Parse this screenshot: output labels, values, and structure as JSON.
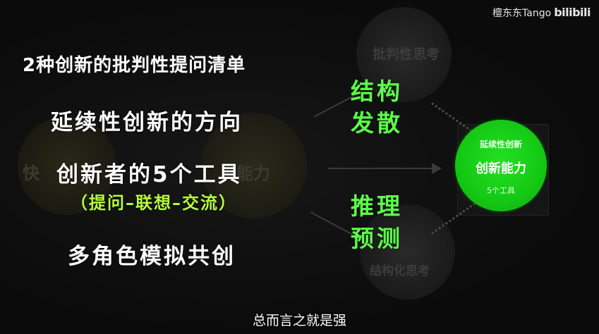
{
  "watermark": {
    "uploader": "檀东东Tango",
    "logo_text": "bilibili"
  },
  "background": {
    "top_circle_text": "批判性思考",
    "bottom_circle_text": "结构化思考",
    "left_circle_text": "快",
    "middle_circle_text": "能力"
  },
  "slide": {
    "title": "2种创新的批判性提问清单",
    "item1": "延续性创新的方向",
    "item2": "创新者的5个工具",
    "item3": "（提问–联想–交流）",
    "item4": "多角色模拟共创"
  },
  "green_labels": {
    "line1": "结构",
    "line2": "发散",
    "line3": "推理",
    "line4": "预测"
  },
  "green_circle": {
    "top": "延续性创新",
    "middle": "创新能力",
    "bottom": "5个工具"
  },
  "subtitle": "总而言之就是强",
  "colors": {
    "accent_green": "#5cff4a",
    "circle_green": "#14c814",
    "parenthetical_green": "#b6ff3a",
    "background": "#0b0b0b"
  }
}
